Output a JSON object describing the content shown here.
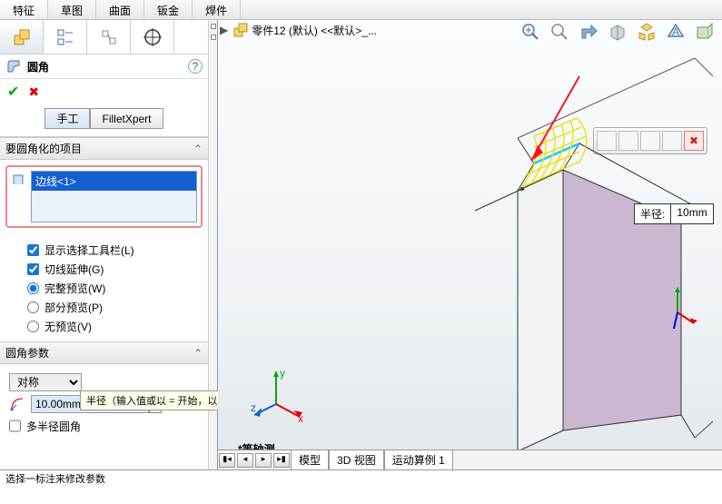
{
  "tabs": {
    "t1": "特征",
    "t2": "草图",
    "t3": "曲面",
    "t4": "钣金",
    "t5": "焊件"
  },
  "breadcrumb": {
    "part": "零件12 (默认) <<默认>_..."
  },
  "feature": {
    "name": "圆角",
    "help": "?"
  },
  "subtabs": {
    "manual": "手工",
    "expert": "FilletXpert"
  },
  "section1": {
    "title": "要圆角化的项目"
  },
  "selected_edge": "边线<1>",
  "cb1": "显示选择工具栏(L)",
  "cb2": "切线延伸(G)",
  "rb1": "完整预览(W)",
  "rb2": "部分预览(P)",
  "rb3": "无预览(V)",
  "section2": {
    "title": "圆角参数"
  },
  "symmetric": "对称",
  "radius_value": "10.00mm",
  "cb3": "多半径圆角",
  "tooltip": "半径（输入值或以 = 开始，以创建方程式）",
  "callout": {
    "label": "半径:",
    "value": "10mm"
  },
  "viewbtm": {
    "tab1": "模型",
    "tab2": "3D 视图",
    "tab3": "运动算例 1"
  },
  "isometric": "*等轴测",
  "status": "选择一标注来修改参数"
}
